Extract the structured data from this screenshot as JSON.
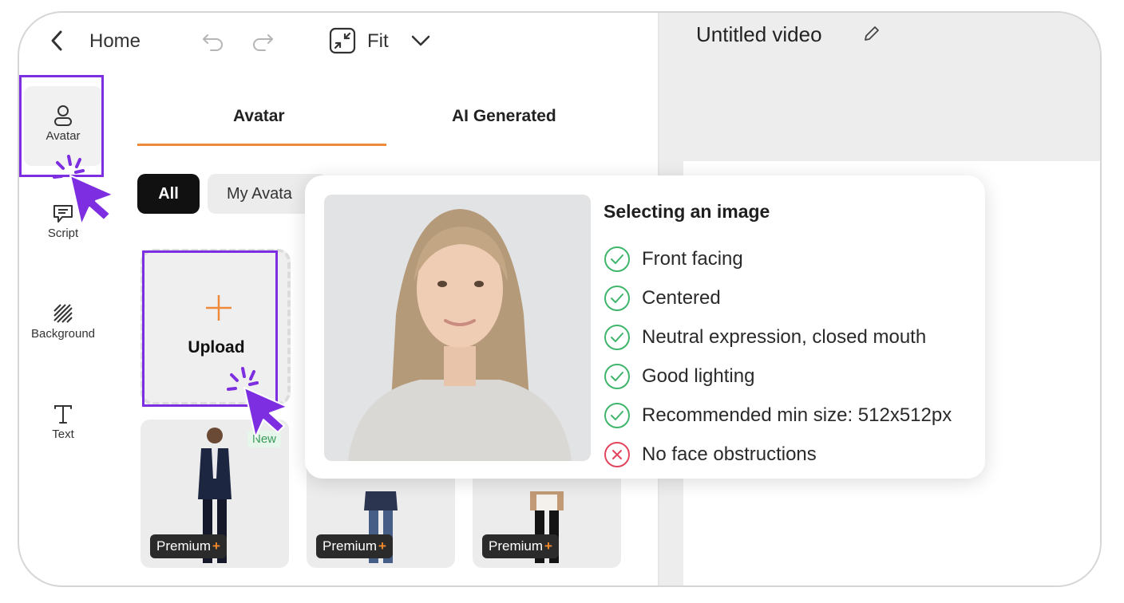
{
  "header": {
    "home_label": "Home",
    "fit_label": "Fit",
    "video_title": "Untitled video"
  },
  "sidebar": {
    "items": [
      {
        "label": "Avatar",
        "icon": "user-icon"
      },
      {
        "label": "Script",
        "icon": "chat-icon"
      },
      {
        "label": "Background",
        "icon": "hatch-icon"
      },
      {
        "label": "Text",
        "icon": "text-icon"
      }
    ]
  },
  "tabs": [
    {
      "label": "Avatar",
      "active": true
    },
    {
      "label": "AI Generated",
      "active": false
    }
  ],
  "filters": [
    {
      "label": "All",
      "active": true
    },
    {
      "label": "My Avata",
      "active": false
    }
  ],
  "upload": {
    "label": "Upload"
  },
  "avatar_cards": [
    {
      "badge": "Premium",
      "new_label": "New"
    },
    {
      "badge": "Premium"
    },
    {
      "badge": "Premium"
    }
  ],
  "badge_plus": "+",
  "popover": {
    "title": "Selecting an image",
    "tips": [
      {
        "text": "Front facing",
        "ok": true
      },
      {
        "text": "Centered",
        "ok": true
      },
      {
        "text": "Neutral expression, closed mouth",
        "ok": true
      },
      {
        "text": "Good lighting",
        "ok": true
      },
      {
        "text": "Recommended min size: 512x512px",
        "ok": true
      },
      {
        "text": "No face obstructions",
        "ok": false
      }
    ]
  },
  "colors": {
    "accent_orange": "#ef8a3a",
    "highlight_purple": "#7c2ee0",
    "ok_green": "#3fb56b",
    "bad_red": "#e2445c"
  }
}
